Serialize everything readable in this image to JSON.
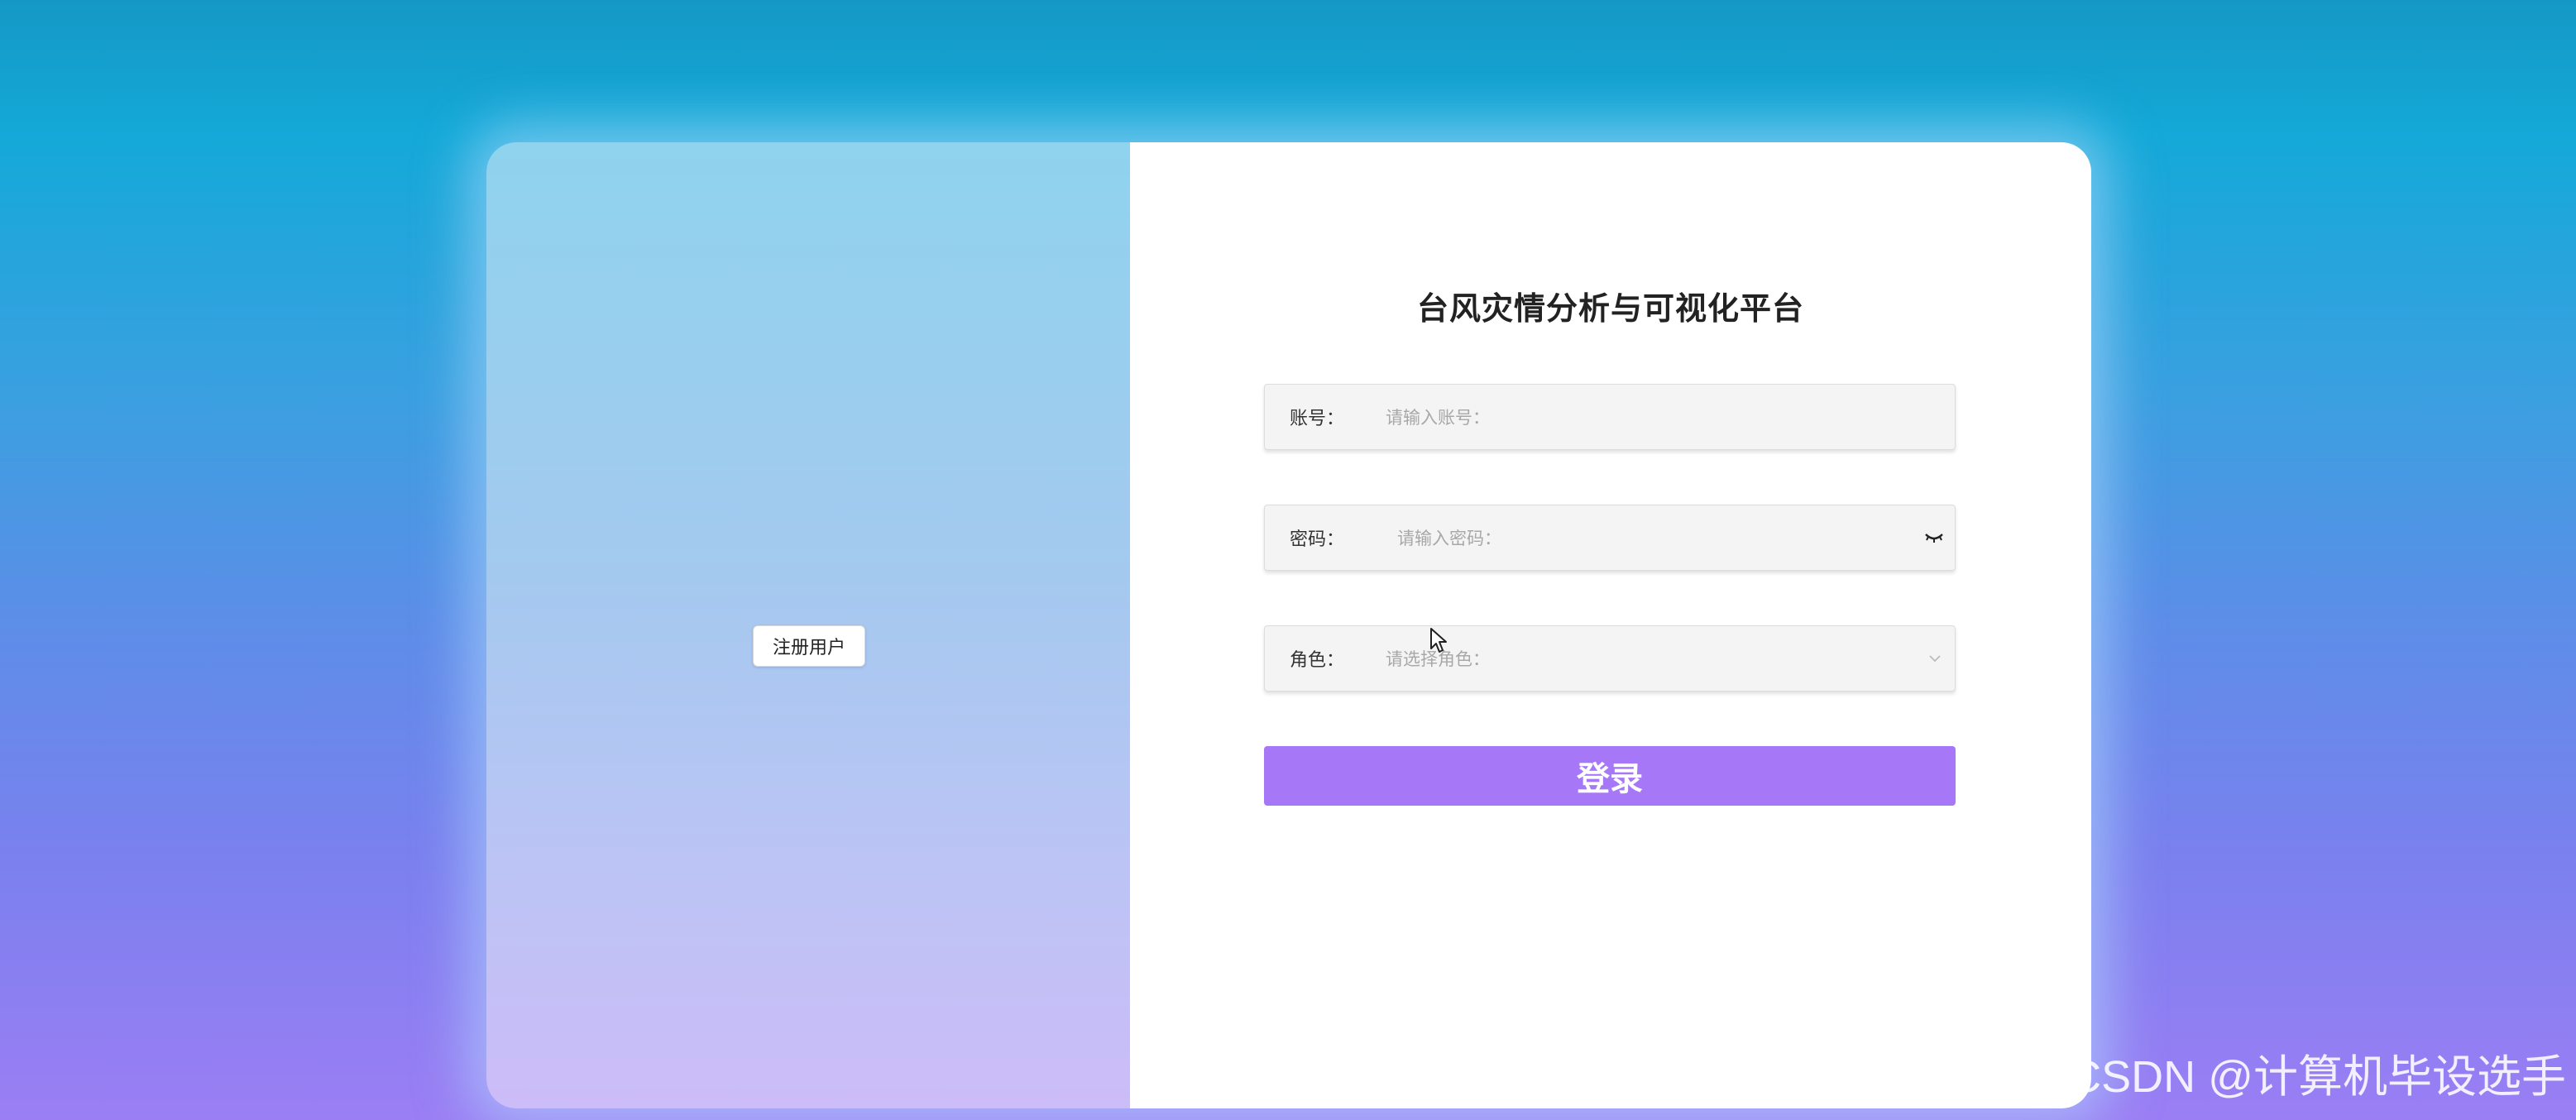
{
  "left_panel": {
    "register_label": "注册用户"
  },
  "form": {
    "title": "台风灾情分析与可视化平台",
    "username": {
      "label": "账号：",
      "placeholder": "请输入账号："
    },
    "password": {
      "label": "密码：",
      "placeholder": "请输入密码：",
      "toggle_icon": "eye-closed-icon"
    },
    "role": {
      "label": "角色：",
      "placeholder": "请选择角色：",
      "dropdown_icon": "chevron-down-icon"
    },
    "login_label": "登录"
  },
  "watermark": "CSDN @计算机毕设选手",
  "colors": {
    "accent": "#a678f7",
    "left_panel_top": "#8fd3ee",
    "left_panel_bottom": "#ccbcf8",
    "background_top": "#1598c5",
    "background_bottom": "#9b7ef4"
  }
}
